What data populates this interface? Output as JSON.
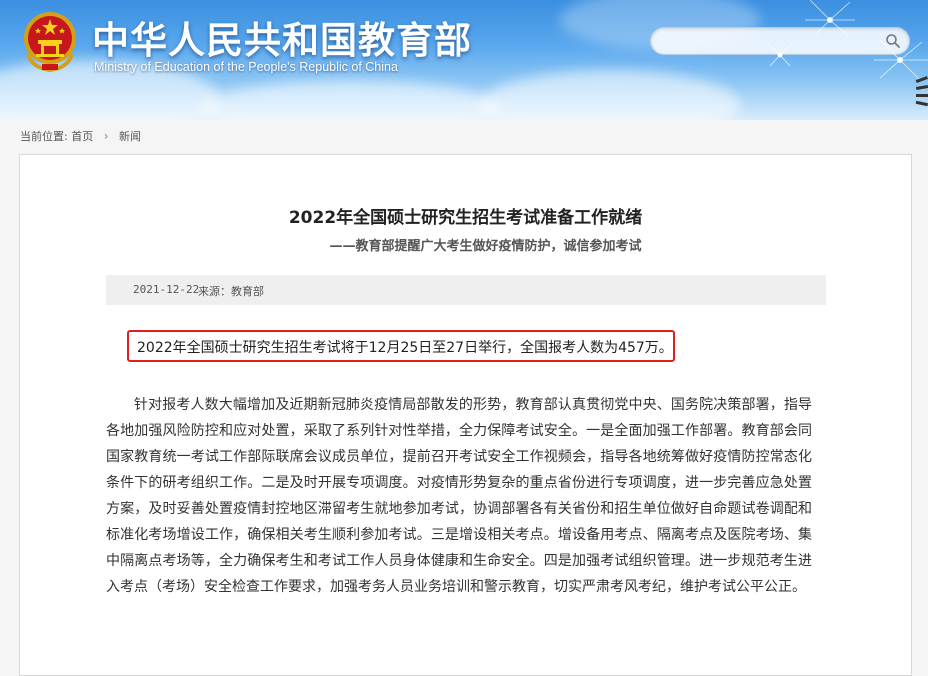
{
  "header": {
    "title": "中华人民共和国教育部",
    "subtitle": "Ministry of Education of the People's Republic of China",
    "emblem_icon": "national-emblem-icon",
    "search": {
      "placeholder": "",
      "icon": "search-icon"
    }
  },
  "breadcrumb": {
    "label": "当前位置:",
    "items": [
      "首页",
      "新闻"
    ]
  },
  "article": {
    "title": "2022年全国硕士研究生招生考试准备工作就绪",
    "subtitle": "——教育部提醒广大考生做好疫情防护，诚信参加考试",
    "date": "2021-12-22",
    "source": "来源：教育部",
    "highlight": "2022年全国硕士研究生招生考试将于12月25日至27日举行，全国报考人数为457万。",
    "highlight_color": "#e02020",
    "paragraph": "针对报考人数大幅增加及近期新冠肺炎疫情局部散发的形势，教育部认真贯彻党中央、国务院决策部署，指导各地加强风险防控和应对处置，采取了系列针对性举措，全力保障考试安全。一是全面加强工作部署。教育部会同国家教育统一考试工作部际联席会议成员单位，提前召开考试安全工作视频会，指导各地统筹做好疫情防控常态化条件下的研考组织工作。二是及时开展专项调度。对疫情形势复杂的重点省份进行专项调度，进一步完善应急处置方案，及时妥善处置疫情封控地区滞留考生就地参加考试，协调部署各有关省份和招生单位做好自命题试卷调配和标准化考场增设工作，确保相关考生顺利参加考试。三是增设相关考点。增设备用考点、隔离考点及医院考场、集中隔离点考场等，全力确保考生和考试工作人员身体健康和生命安全。四是加强考试组织管理。进一步规范考生进入考点（考场）安全检查工作要求，加强考务人员业务培训和警示教育，切实严肃考风考纪，维护考试公平公正。"
  }
}
